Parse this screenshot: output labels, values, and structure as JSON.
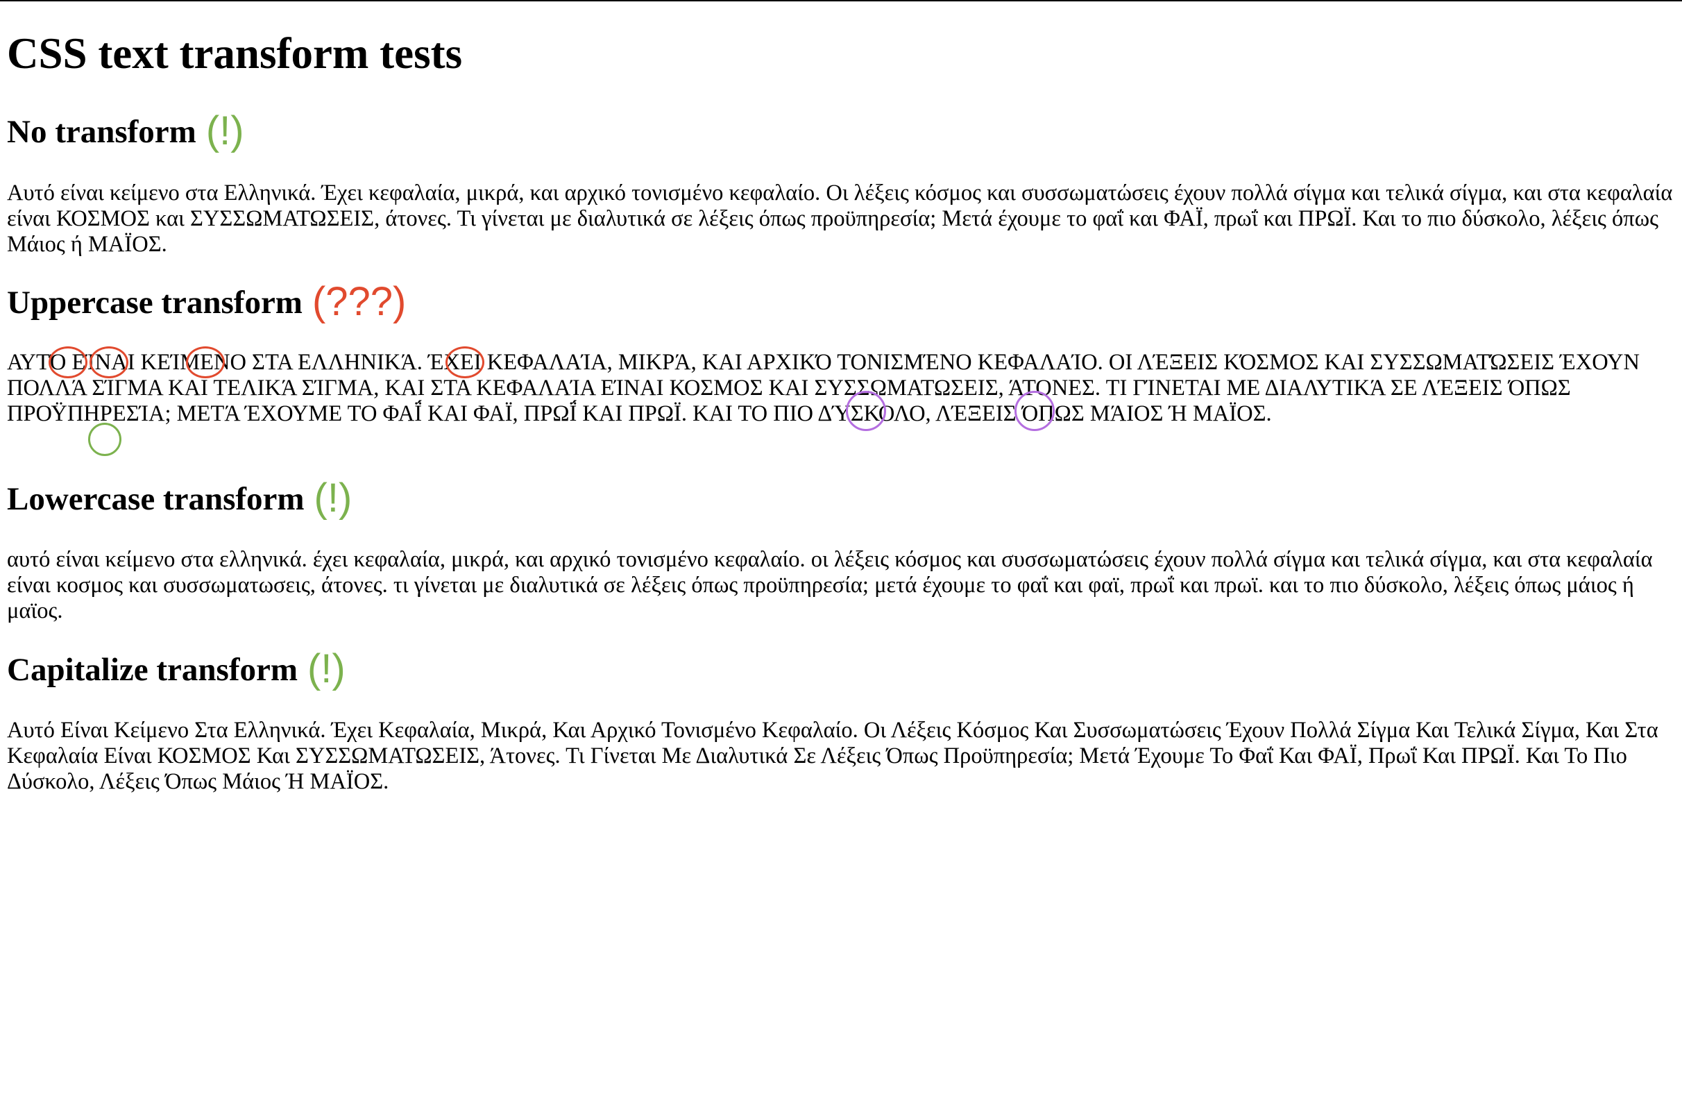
{
  "page_title": "CSS text transform tests",
  "colors": {
    "ok_mark": "#7cb24e",
    "bad_mark": "#e14a2e",
    "annotation_purple": "#b46ee0",
    "annotation_green": "#7cb24e"
  },
  "sample_text": "Αυτό είναι κείμενο στα Ελληνικά. Έχει κεφαλαία, μικρά, και αρχικό τονισμένο κεφαλαίο. Οι λέξεις κόσμος και συσσωματώσεις έχουν πολλά σίγμα και τελικά σίγμα, και στα κεφαλαία είναι ΚΟΣΜΟΣ και ΣΥΣΣΩΜΑΤΩΣΕΙΣ, άτονες. Τι γίνεται με διαλυτικά σε λέξεις όπως προϋπηρεσία; Μετά έχουμε το φαΐ και ΦΑΪ, πρωΐ και ΠΡΩΪ. Και το πιο δύσκολο, λέξεις όπως Μάιος ή ΜΑΪΟΣ.",
  "sections": [
    {
      "heading": "No transform",
      "mark": "(!)"
    },
    {
      "heading": "Uppercase transform",
      "mark": "(???)"
    },
    {
      "heading": "Lowercase transform",
      "mark": "(!)"
    },
    {
      "heading": "Capitalize transform",
      "mark": "(!)"
    }
  ]
}
